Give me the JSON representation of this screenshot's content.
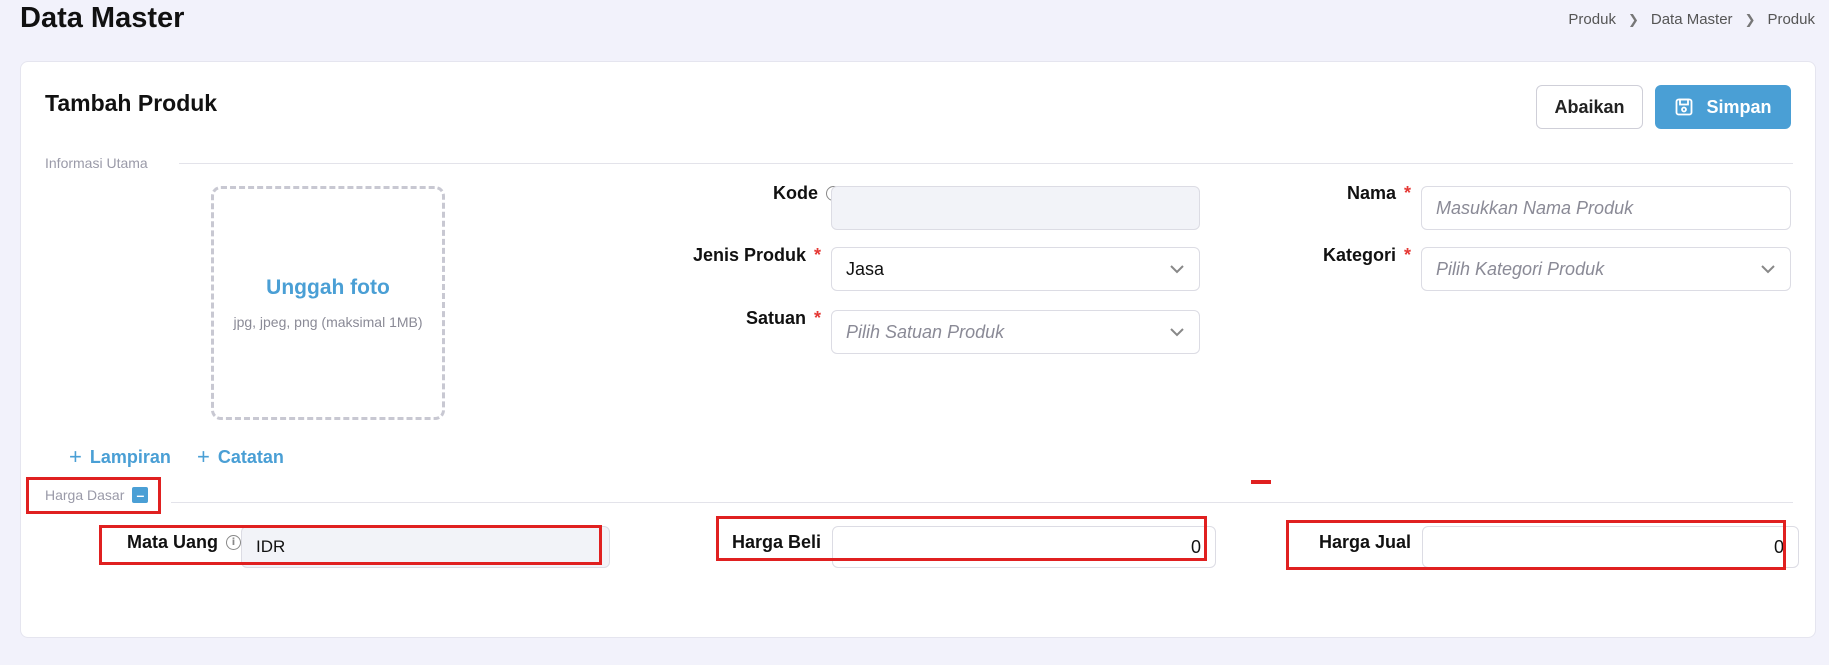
{
  "header": {
    "title": "Data Master",
    "breadcrumb": [
      "Produk",
      "Data Master",
      "Produk"
    ]
  },
  "form": {
    "title": "Tambah Produk",
    "cancel_label": "Abaikan",
    "save_label": "Simpan",
    "sections": {
      "main": "Informasi Utama",
      "price": "Harga Dasar"
    },
    "upload": {
      "title": "Unggah foto",
      "hint": "jpg, jpeg, png (maksimal 1MB)"
    },
    "fields": {
      "kode": {
        "label": "Kode",
        "value": ""
      },
      "jenis": {
        "label": "Jenis Produk",
        "value": "Jasa"
      },
      "satuan": {
        "label": "Satuan",
        "placeholder": "Pilih Satuan Produk"
      },
      "nama": {
        "label": "Nama",
        "placeholder": "Masukkan Nama Produk"
      },
      "kategori": {
        "label": "Kategori",
        "placeholder": "Pilih Kategori Produk"
      },
      "mata_uang": {
        "label": "Mata Uang",
        "value": "IDR"
      },
      "harga_beli": {
        "label": "Harga Beli",
        "value": "0"
      },
      "harga_jual": {
        "label": "Harga Jual",
        "value": "0"
      }
    },
    "required_mark": "*",
    "links": {
      "lampiran": "Lampiran",
      "catatan": "Catatan"
    }
  },
  "colors": {
    "accent": "#4a9fd5",
    "required": "#e53935",
    "highlight": "#e02020"
  }
}
